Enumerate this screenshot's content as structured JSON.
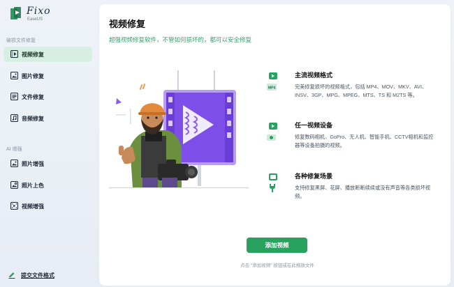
{
  "app": {
    "logo_title": "Fixo",
    "logo_subtitle": "EaseUS"
  },
  "sidebar": {
    "section_repair": "破损文件修复",
    "repair_items": [
      {
        "label": "视频修复",
        "icon": "video-icon",
        "active": true
      },
      {
        "label": "图片修复",
        "icon": "image-icon",
        "active": false
      },
      {
        "label": "文件修复",
        "icon": "document-icon",
        "active": false
      },
      {
        "label": "音频修复",
        "icon": "audio-icon",
        "active": false
      }
    ],
    "section_ai": "AI 增强",
    "ai_items": [
      {
        "label": "照片增强",
        "icon": "photo-enhance-icon"
      },
      {
        "label": "照片上色",
        "icon": "photo-colorize-icon"
      },
      {
        "label": "视频增强",
        "icon": "video-enhance-icon"
      }
    ],
    "feedback_label": "提交文件格式"
  },
  "main": {
    "title": "视频修复",
    "subtitle": "超强视频修复软件，不管如何损坏的，都可以安全修复",
    "features": [
      {
        "title": "主流视频格式",
        "desc": "完美修复损坏的视频格式，包括 MP4、MOV、MKV、AVI、INSV、3GP、MPG、MPEG、MTS、TS 和 M2TS 等。",
        "icon": "video-format-icon"
      },
      {
        "title": "任一视频设备",
        "desc": "修复数码相机、GoPro、无人机、智能手机、CCTV相机和监控器等设备拍摄的视频。",
        "icon": "camera-device-icon"
      },
      {
        "title": "各种修复场景",
        "desc": "支持修复黑屏、花屏、播放断断续续或没有声音等各类损坏视频。",
        "icon": "repair-scene-icon"
      }
    ],
    "add_button": "添加视频",
    "hint": "点击 \"添加视频\" 按钮或在此拖放文件"
  },
  "colors": {
    "accent": "#27a35f",
    "active_nav_bg": "#d7eee3",
    "illustration_purple": "#8a5cf0"
  }
}
